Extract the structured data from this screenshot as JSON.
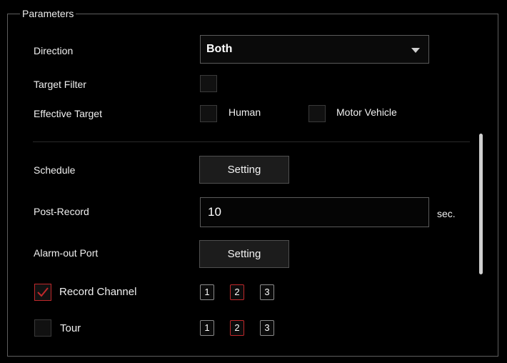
{
  "panel": {
    "legend": "Parameters"
  },
  "direction": {
    "label": "Direction",
    "value": "Both"
  },
  "target_filter": {
    "label": "Target Filter",
    "checked": false
  },
  "effective_target": {
    "label": "Effective Target",
    "options": [
      {
        "label": "Human",
        "checked": false
      },
      {
        "label": "Motor Vehicle",
        "checked": false
      }
    ]
  },
  "schedule": {
    "label": "Schedule",
    "button": "Setting"
  },
  "post_record": {
    "label": "Post-Record",
    "value": "10",
    "unit": "sec."
  },
  "alarm_out": {
    "label": "Alarm-out Port",
    "button": "Setting"
  },
  "record_channel": {
    "label": "Record Channel",
    "checked": true,
    "channels": [
      {
        "label": "1",
        "selected": false
      },
      {
        "label": "2",
        "selected": true
      },
      {
        "label": "3",
        "selected": false
      }
    ]
  },
  "tour": {
    "label": "Tour",
    "checked": false,
    "channels": [
      {
        "label": "1",
        "selected": false
      },
      {
        "label": "2",
        "selected": true
      },
      {
        "label": "3",
        "selected": false
      }
    ]
  },
  "colors": {
    "accent": "#c0282b",
    "background": "#000000"
  }
}
